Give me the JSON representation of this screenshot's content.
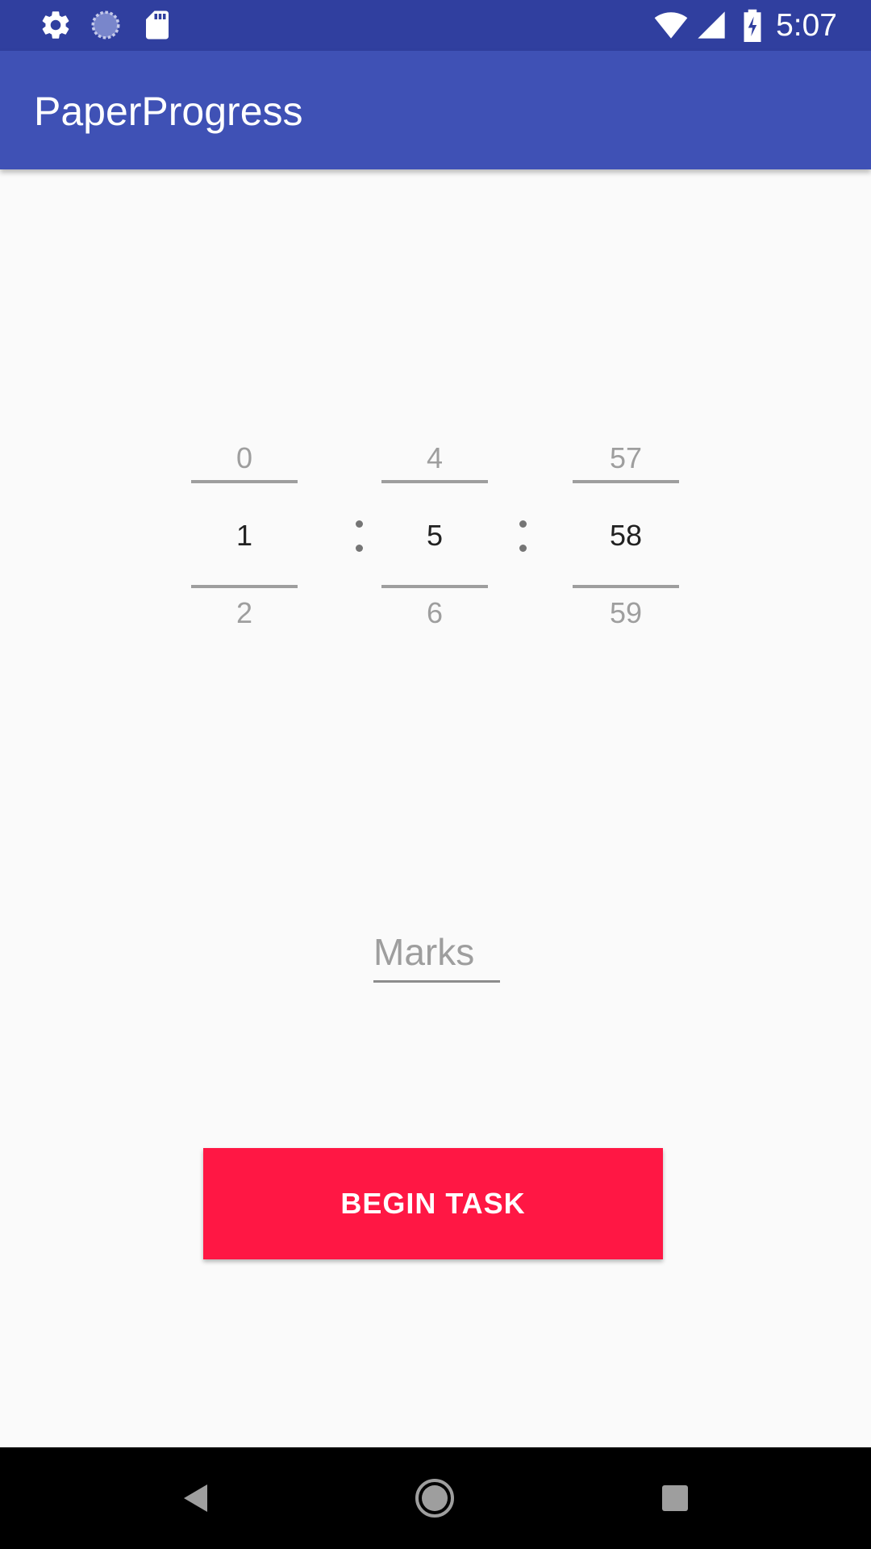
{
  "status_bar": {
    "time": "5:07",
    "icons": [
      "gear-icon",
      "sync-progress-icon",
      "sd-card-icon",
      "wifi-icon",
      "signal-icon",
      "battery-charging-icon"
    ]
  },
  "app_bar": {
    "title": "PaperProgress"
  },
  "time_picker": {
    "hours": {
      "prev": "0",
      "current": "1",
      "next": "2"
    },
    "minutes": {
      "prev": "4",
      "current": "5",
      "next": "6"
    },
    "seconds": {
      "prev": "57",
      "current": "58",
      "next": "59"
    }
  },
  "marks_field": {
    "placeholder": "Marks",
    "value": ""
  },
  "begin_button": {
    "label": "BEGIN TASK"
  },
  "nav_bar": {
    "icons": [
      "back-icon",
      "home-icon",
      "recents-icon"
    ]
  },
  "colors": {
    "status_bar": "#303f9f",
    "app_bar": "#3f51b5",
    "accent": "#ff1744",
    "background": "#fafafa"
  }
}
